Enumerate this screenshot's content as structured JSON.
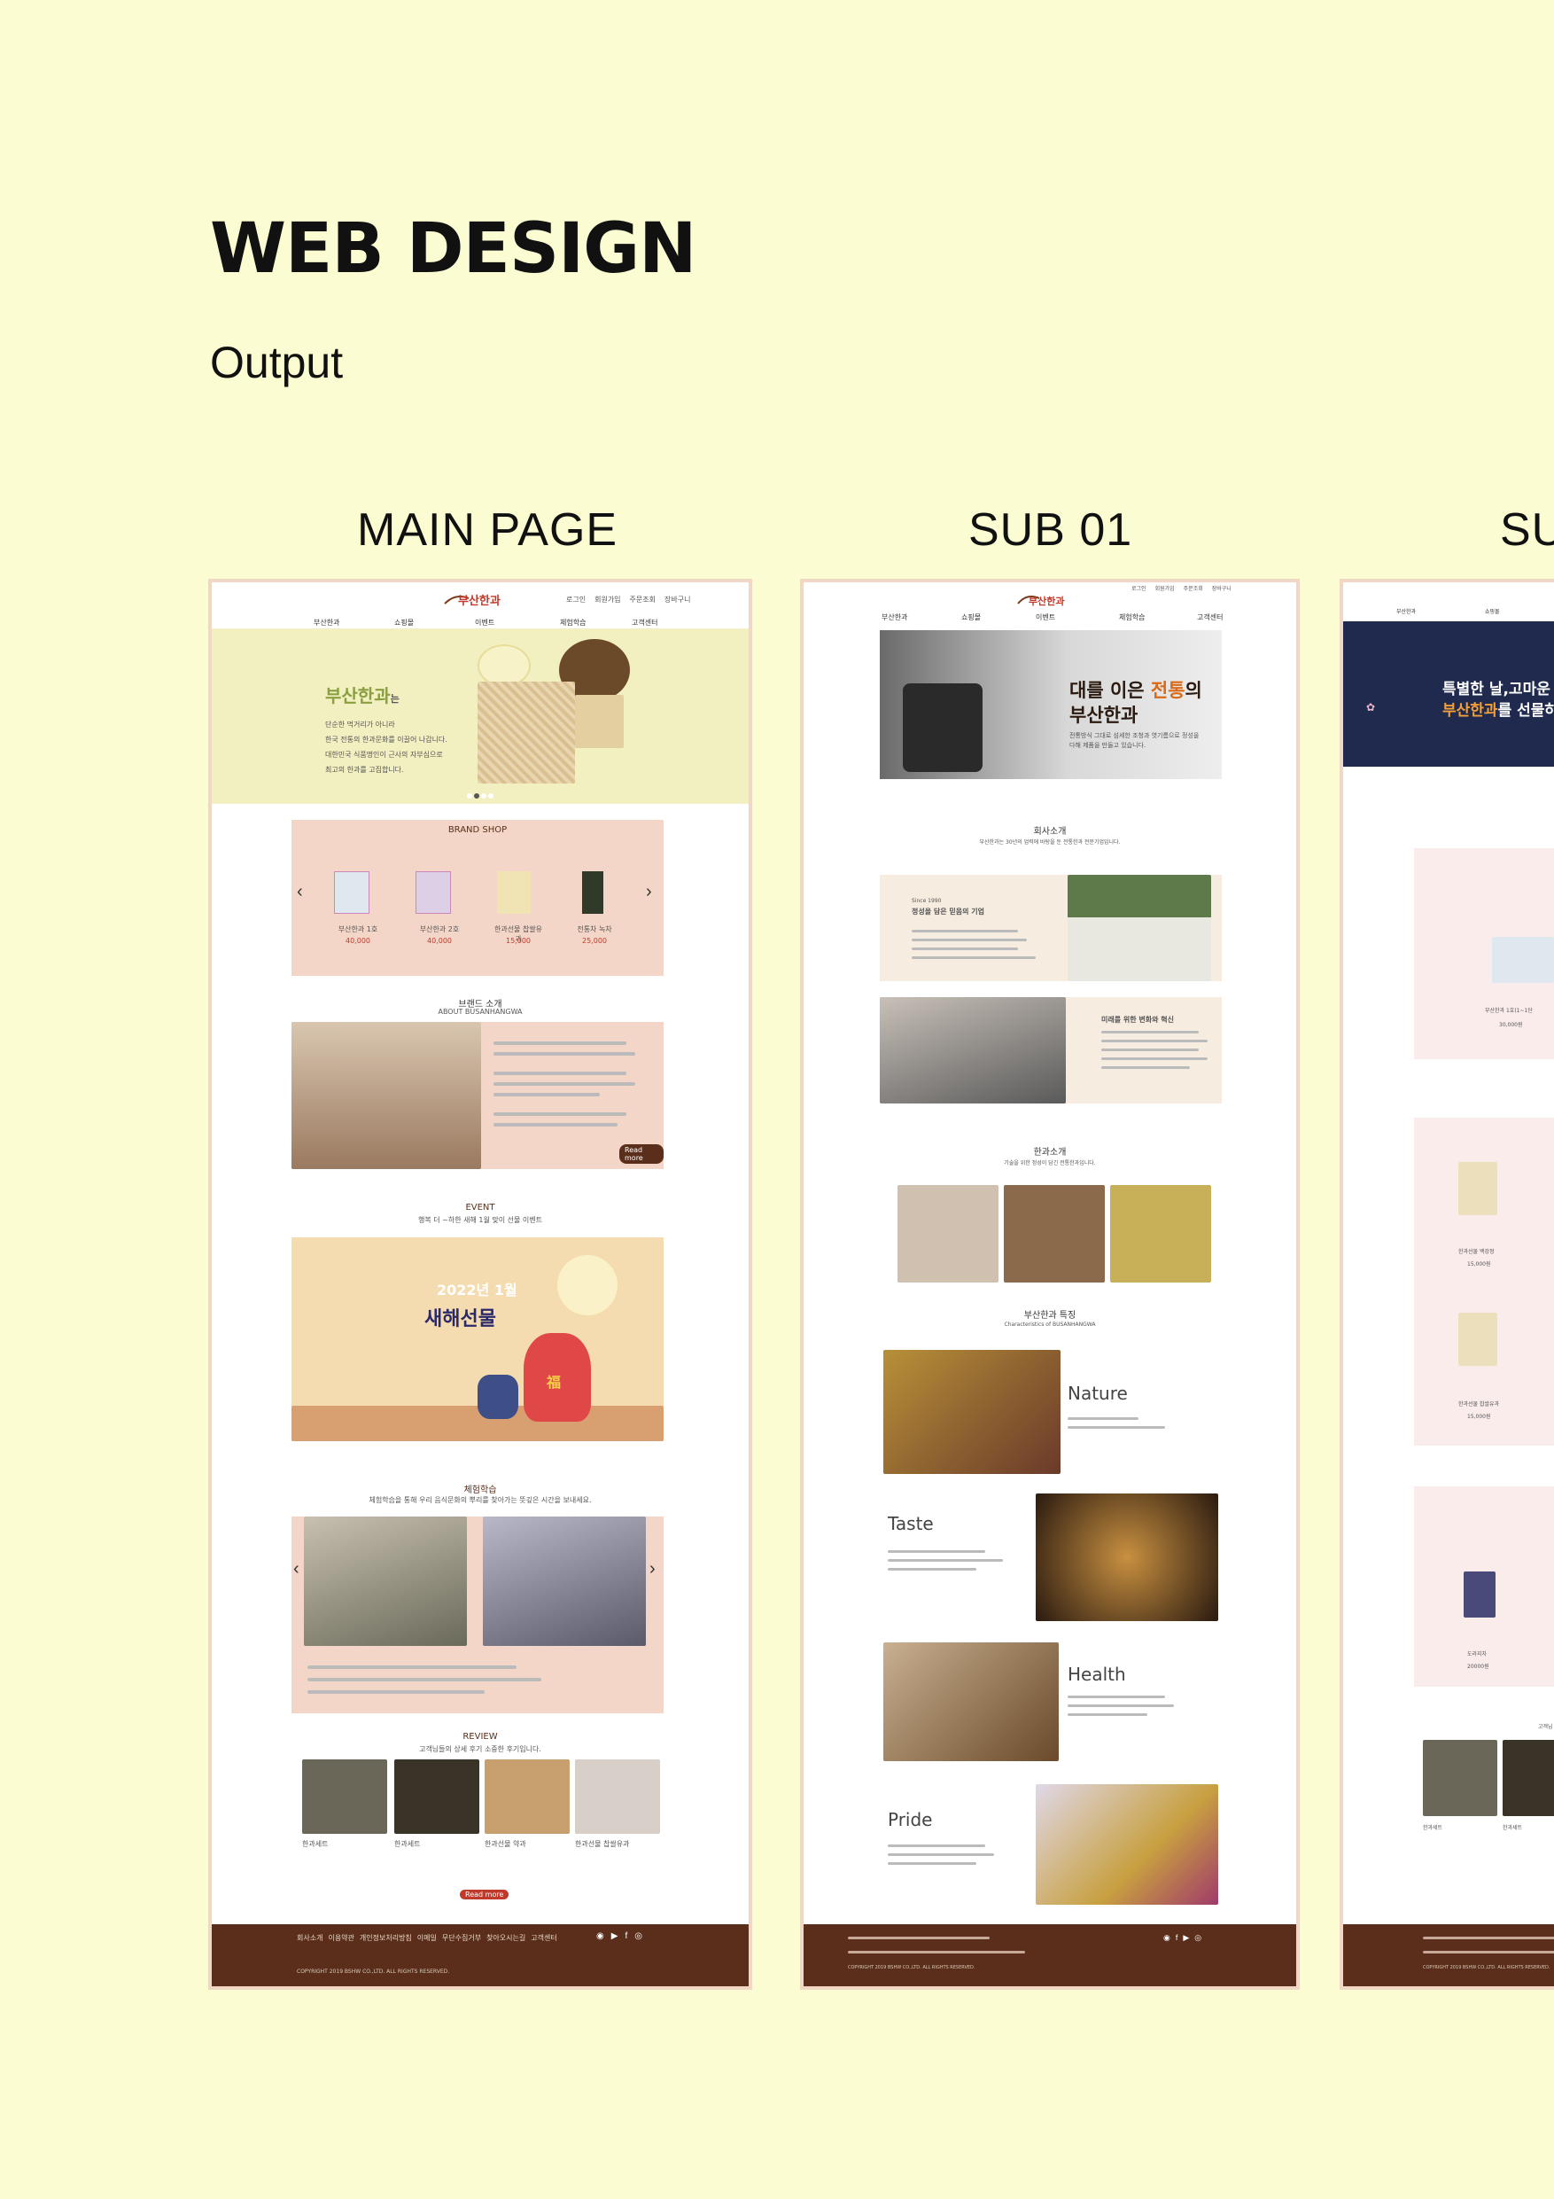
{
  "header": {
    "title": "WEB DESIGN",
    "subtitle": "Output"
  },
  "labels": {
    "main": "MAIN PAGE",
    "sub01": "SUB 01",
    "sub02": "SU"
  },
  "main_page": {
    "nav_top": [
      "로그인",
      "회원가입",
      "주문조회",
      "장바구니"
    ],
    "nav": [
      "부산한과",
      "쇼핑몰",
      "이벤트",
      "체험학습",
      "고객센터"
    ],
    "hero_title": "부산한과",
    "hero_title_suffix": "는",
    "hero_lines": [
      "단순한 먹거리가 아니라",
      "한국 전통의 한과문화를 이끌어 나갑니다.",
      "대한민국 식품명인이 근사의 자부심으로",
      "최고의 한과를 고집합니다."
    ],
    "brand_shop": "BRAND SHOP",
    "products": [
      {
        "name": "부산한과 1호",
        "price": "40,000"
      },
      {
        "name": "부산한과 2호",
        "price": "40,000"
      },
      {
        "name": "한과선물 찹쌀유과",
        "price": "15,000"
      },
      {
        "name": "전통차 녹차",
        "price": "25,000"
      }
    ],
    "brand_intro_title": "브랜드 소개",
    "brand_intro_sub": "ABOUT BUSANHANGWA",
    "read_more": "Read more",
    "event_title": "EVENT",
    "event_sub": "행복 더 ~하한 새해 1월 맞이 선물 이벤트",
    "event_banner_year": "2022년 1월",
    "event_banner_title": "새해선물",
    "event_banner_tag": "福",
    "experience_title": "체험학습",
    "experience_sub": "체험학습을 통해 우리 음식문화의 뿌리를 찾아가는 뜻깊은 시간을 보내세요.",
    "review_title": "REVIEW",
    "review_sub": "고객님들의 상세 후기 소중한 후기입니다.",
    "reviews": [
      "한과세트",
      "한과세트",
      "한과선물 약과",
      "한과선물 찹쌀유과"
    ],
    "review_more": "Read more",
    "footer_links": [
      "회사소개",
      "이용약관",
      "개인정보처리방침",
      "이메일",
      "무단수집거부",
      "찾아오시는길",
      "고객센터"
    ],
    "footer_copy": "COPYRIGHT 2019 BSHW CO.,LTD. ALL RIGHTS RESERVED."
  },
  "sub01": {
    "nav_top": [
      "로그인",
      "회원가입",
      "주문조회",
      "장바구니"
    ],
    "nav": [
      "부산한과",
      "쇼핑몰",
      "이벤트",
      "체험학습",
      "고객센터"
    ],
    "hero_title_a": "대를 이은 ",
    "hero_title_hl": "전통",
    "hero_title_b": "의",
    "hero_title2": "부산한과",
    "hero_desc": "전통방식 그대로 섬세한 조청과 엿기름으로 정성을 다해 제품을 만들고 있습니다.",
    "company_title": "회사소개",
    "company_sub": "부산한과는 30년의 업력에 바탕을 둔 전통한과 전문기업입니다.",
    "since": "Since 1990",
    "since_title": "정성을 담은 믿음의 기업",
    "innovation_title": "미래를 위한 변화와 혁신",
    "hangwa_title": "한과소개",
    "hangwa_sub": "기술을 위한 정성이 담긴 전통한과입니다.",
    "feature_title": "부산한과 특징",
    "feature_sub": "Characteristics of BUSANHANGWA",
    "features": [
      "Nature",
      "Taste",
      "Health",
      "Pride"
    ],
    "footer_copy": "COPYRIGHT 2019 BSHW CO.,LTD. ALL RIGHTS RESERVED."
  },
  "sub02": {
    "nav": [
      "부산한과",
      "쇼핑몰"
    ],
    "hero_line1": "특별한 날,고마운",
    "hero_line2_hl": "부산한과",
    "hero_line2_rest": "를 선물하",
    "items": [
      {
        "name": "부산한과 1호(1~1단",
        "price": "30,000원"
      },
      {
        "name": "한과선물 백강정",
        "price": "15,000원"
      },
      {
        "name": "한과선물 찹쌀유과",
        "price": "15,000원"
      },
      {
        "name": "도라지차",
        "price": "20000원"
      }
    ],
    "review_heading": "고객님",
    "reviews": [
      "한과세트",
      "한과세트"
    ],
    "footer_copy": "COPYRIGHT 2019 BSHW CO.,LTD. ALL RIGHTS RESERVED."
  },
  "colors": {
    "background": "#fcfcd2",
    "frame_border": "#f1d7c6",
    "brand_pink": "#f4d6c8",
    "footer_brown": "#5a2e1a",
    "accent_red": "#c0392b",
    "hero_cream": "#f2efc1"
  }
}
